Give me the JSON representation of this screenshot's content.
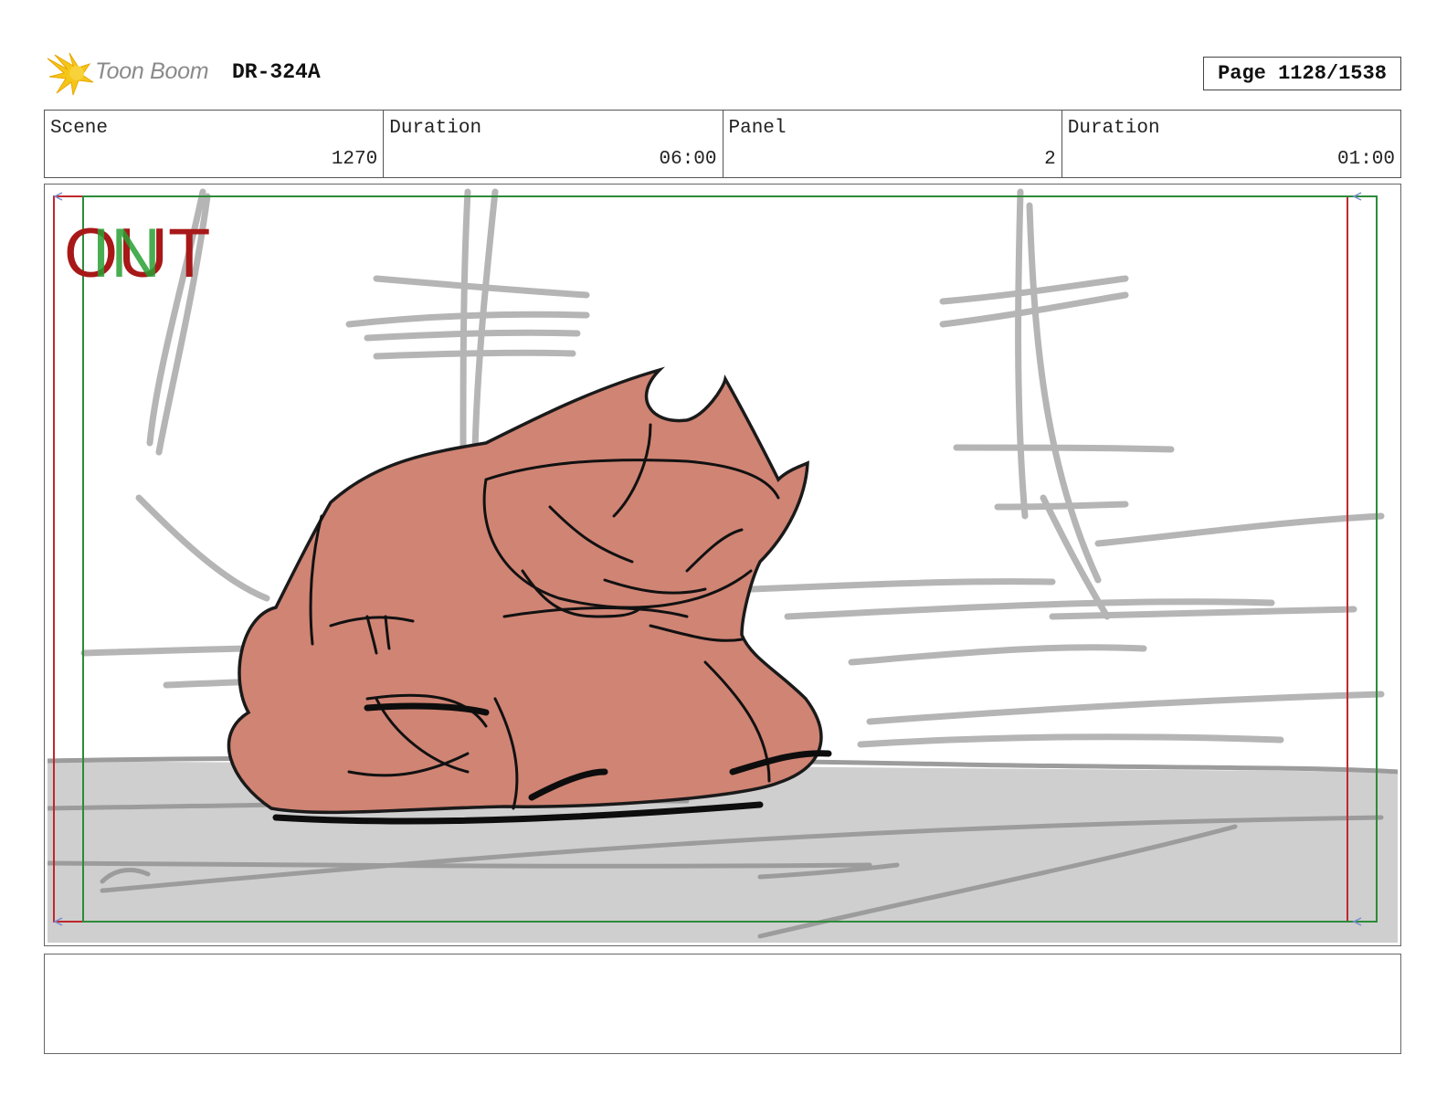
{
  "header": {
    "logo_text": "Toon Boom",
    "board_id": "DR-324A",
    "page_label": "Page 1128/1538"
  },
  "info": {
    "scene_label": "Scene",
    "scene_value": "1270",
    "scene_duration_label": "Duration",
    "scene_duration_value": "06:00",
    "panel_label": "Panel",
    "panel_value": "2",
    "panel_duration_label": "Duration",
    "panel_duration_value": "01:00"
  },
  "panel": {
    "out_label": "OUT",
    "in_label": "IN",
    "colors": {
      "out_frame": "#c0272d",
      "in_frame": "#2e8b3a",
      "character_fill": "#d08474",
      "ground": "#cfcfcf",
      "sketch": "#b5b5b5"
    }
  },
  "notes": {
    "text": ""
  }
}
